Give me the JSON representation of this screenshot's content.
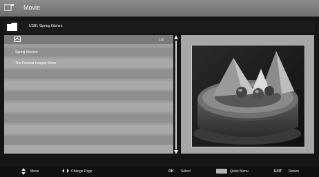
{
  "title": "Movie",
  "path": "USB1 /Spring Kitchen",
  "list": {
    "page_count": "1/2",
    "items": [
      "Spring Kitchen",
      "The Festival League Show"
    ]
  },
  "footer": {
    "move_label": "Move",
    "page_label": "Change Page",
    "ok_key": "OK",
    "select_label": "Select",
    "menu_label": "Quick Menu",
    "exit_key": "EXIT",
    "return_label": "Return"
  },
  "icons": [
    "app-icon",
    "folder-icon",
    "up-folder-icon",
    "scroll-up-icon",
    "scroll-down-icon",
    "updown-arrows-icon",
    "leftright-arrows-icon"
  ],
  "colors": {
    "titlebar": "#7e7e7e",
    "pathbar": "#1b1b1b",
    "list_background": "#9c9c9c",
    "footer": "#101010"
  }
}
